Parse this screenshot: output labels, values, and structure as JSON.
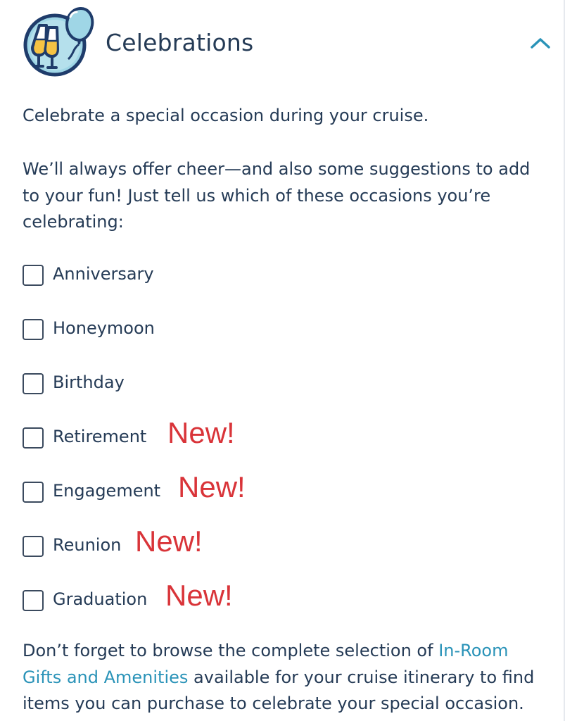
{
  "header": {
    "title": "Celebrations",
    "icon": "celebration-balloon-glasses-icon",
    "toggle_icon": "chevron-up-icon"
  },
  "intro": "Celebrate a special occasion during your cruise.",
  "body": "We’ll always offer cheer—and also some suggestions to add to your fun! Just tell us which of these occasions you’re celebrating:",
  "options": [
    {
      "label": "Anniversary",
      "new_tag": ""
    },
    {
      "label": "Honeymoon",
      "new_tag": ""
    },
    {
      "label": "Birthday",
      "new_tag": ""
    },
    {
      "label": "Retirement",
      "new_tag": "New!"
    },
    {
      "label": "Engagement",
      "new_tag": "New!"
    },
    {
      "label": "Reunion",
      "new_tag": "New!"
    },
    {
      "label": "Graduation",
      "new_tag": "New!"
    }
  ],
  "footer": {
    "before_link": "Don’t forget to browse the complete selection of ",
    "link_text": "In-Room Gifts and Amenities",
    "after_link": " available for your cruise itinerary to find items you can purchase to celebrate your special occasion."
  },
  "colors": {
    "text": "#253b56",
    "accent_link": "#2a93b8",
    "new_tag": "#d93439",
    "icon_bg": "#1f3c6b",
    "icon_circle_fill": "#9fd6e6"
  }
}
